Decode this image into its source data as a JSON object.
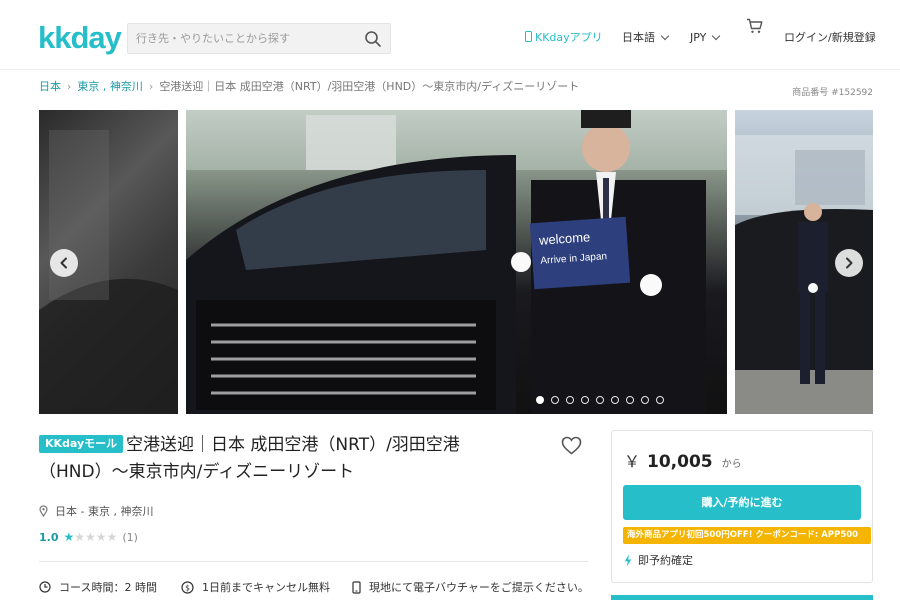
{
  "header": {
    "logo": "kkday",
    "search_placeholder": "行き先・やりたいことから探す",
    "app_link": "KKdayアプリ",
    "language": "日本語",
    "currency": "JPY",
    "login": "ログイン/新規登録"
  },
  "breadcrumb": {
    "items": [
      "日本",
      "東京 , 神奈川"
    ],
    "current": "空港送迎｜日本 成田空港（NRT）/羽田空港（HND）〜東京市内/ディズニーリゾート"
  },
  "product_number": "商品番号 #152592",
  "gallery": {
    "sign_line1": "welcome",
    "sign_line2": "Arrive in Japan",
    "dot_count": 9,
    "active_dot": 0
  },
  "product": {
    "badge": "KKdayモール",
    "title": "空港送迎｜日本 成田空港（NRT）/羽田空港（HND）〜東京市内/ディズニーリゾート",
    "location": "日本 - 東京 , 神奈川",
    "rating_score": "1.0",
    "rating_stars": 1,
    "rating_count": "(1)"
  },
  "features": {
    "duration": "コース時間：2 時間",
    "cancel": "1日前までキャンセル無料",
    "voucher": "現地にて電子バウチャーをご提示ください。"
  },
  "booking": {
    "currency_symbol": "￥",
    "price": "10,005",
    "price_suffix": "から",
    "book_button": "購入/予約に進む",
    "coupon": "海外商品アプリ初回500円OFF! クーポンコード: APP500",
    "instant_confirm": "即予約確定"
  },
  "colors": {
    "brand": "#26bec9",
    "coupon": "#f5b400"
  }
}
